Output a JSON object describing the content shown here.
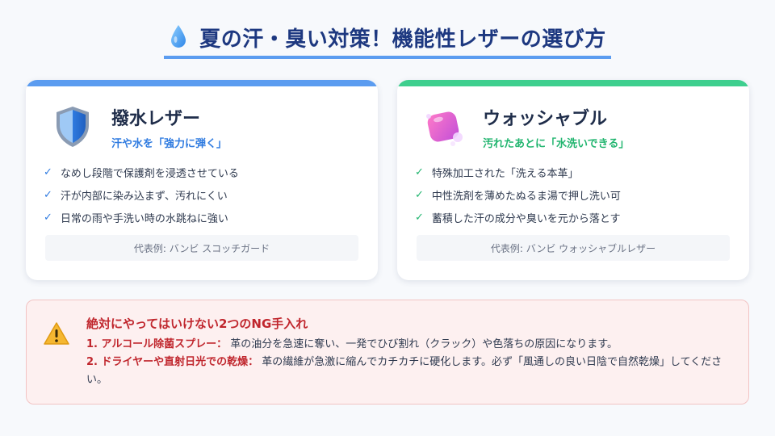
{
  "header": {
    "title": "夏の汗・臭い対策！機能性レザーの選び方",
    "icon": "water-drop-icon",
    "accent": "#5b9cf0"
  },
  "cards": [
    {
      "title": "撥水レザー",
      "subtitle": "汗や水を「強力に弾く」",
      "icon": "shield-icon",
      "color": "#5b9cf0",
      "features": [
        "なめし段階で保護剤を浸透させている",
        "汗が内部に染み込まず、汚れにくい",
        "日常の雨や手洗い時の水跳ねに強い"
      ],
      "example": "代表例: バンビ スコッチガード"
    },
    {
      "title": "ウォッシャブル",
      "subtitle": "汚れたあとに「水洗いできる」",
      "icon": "soap-bubbles-icon",
      "color": "#3ecf8e",
      "features": [
        "特殊加工された「洗える本革」",
        "中性洗剤を薄めたぬるま湯で押し洗い可",
        "蓄積した汗の成分や臭いを元から落とす"
      ],
      "example": "代表例: バンビ ウォッシャブルレザー"
    }
  ],
  "warning": {
    "icon": "warning-icon",
    "title": "絶対にやってはいけない2つのNG手入れ",
    "items": [
      {
        "label": "1. アルコール除菌スプレー：",
        "text": "革の油分を急速に奪い、一発でひび割れ（クラック）や色落ちの原因になります。"
      },
      {
        "label": "2. ドライヤーや直射日光での乾燥：",
        "text": "革の繊維が急激に縮んでカチカチに硬化します。必ず「風通しの良い日陰で自然乾燥」してください。"
      }
    ]
  }
}
